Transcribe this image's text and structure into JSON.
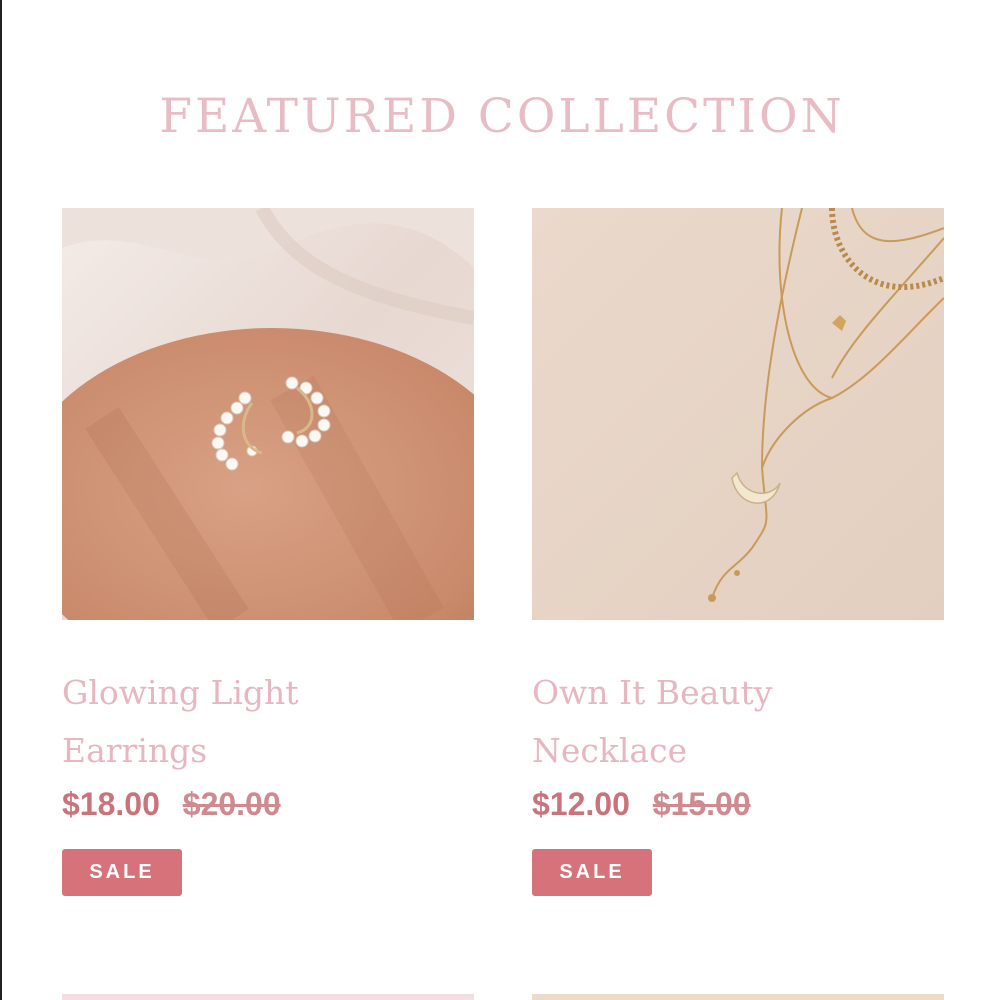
{
  "section": {
    "title": "FEATURED COLLECTION"
  },
  "products": [
    {
      "name_line1": "Glowing Light",
      "name_line2": "Earrings",
      "price": "$18.00",
      "compare_price": "$20.00",
      "badge": "SALE",
      "image_alt": "pearl moon earrings on wooden plate"
    },
    {
      "name_line1": "Own It Beauty",
      "name_line2": "Necklace",
      "price": "$12.00",
      "compare_price": "$15.00",
      "badge": "SALE",
      "image_alt": "layered gold necklace with horn pendant"
    }
  ],
  "colors": {
    "title": "#e8bcc4",
    "product_name": "#e6b7c0",
    "price": "#c9737b",
    "badge_bg": "#d6737a"
  }
}
